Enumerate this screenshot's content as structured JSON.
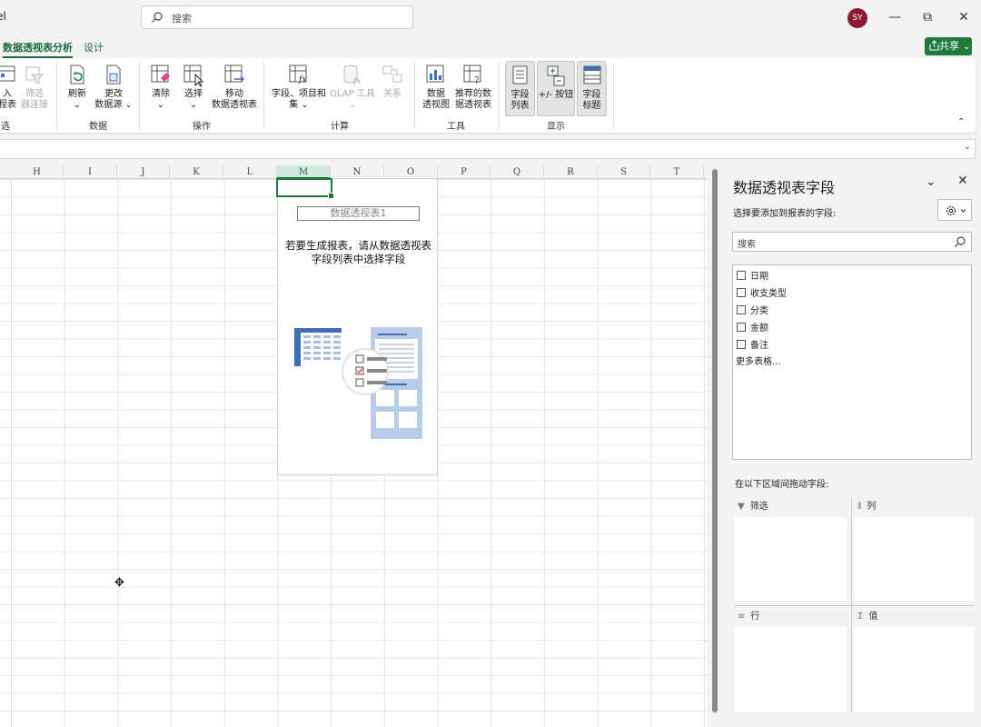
{
  "window": {
    "title_fragment": "el",
    "search_placeholder": "搜索",
    "avatar_initials": "SY",
    "minimize": "—",
    "restore": "⧉",
    "close": "✕"
  },
  "tabs": [
    {
      "label": "数据透视表分析",
      "active": true
    },
    {
      "label": "设计",
      "active": false
    }
  ],
  "share_label": "共享",
  "share_chevron": "⌄",
  "ribbon": {
    "groups": [
      {
        "label": "选",
        "buttons": [
          {
            "label": "入\n程表",
            "icon": "timeline-icon"
          },
          {
            "label": "筛选\n器连接",
            "icon": "filter-connection-icon",
            "disabled": true
          }
        ]
      },
      {
        "label": "数据",
        "buttons": [
          {
            "label": "刷新\n⌄",
            "icon": "refresh-icon"
          },
          {
            "label": "更改\n数据源 ⌄",
            "icon": "change-data-source-icon"
          }
        ]
      },
      {
        "label": "操作",
        "buttons": [
          {
            "label": "清除\n⌄",
            "icon": "clear-icon"
          },
          {
            "label": "选择\n⌄",
            "icon": "select-icon"
          },
          {
            "label": "移动\n数据透视表",
            "icon": "move-pivot-icon"
          }
        ]
      },
      {
        "label": "计算",
        "buttons": [
          {
            "label": "字段、项目和\n集 ⌄",
            "icon": "fields-items-sets-icon"
          },
          {
            "label": "OLAP 工具\n⌄",
            "icon": "olap-tools-icon",
            "disabled": true
          },
          {
            "label": "关系",
            "icon": "relationships-icon",
            "disabled": true
          }
        ]
      },
      {
        "label": "工具",
        "buttons": [
          {
            "label": "数据\n透视图",
            "icon": "pivot-chart-icon"
          },
          {
            "label": "推荐的数\n据透视表",
            "icon": "recommended-pivot-icon"
          }
        ]
      },
      {
        "label": "显示",
        "buttons": [
          {
            "label": "字段\n列表",
            "icon": "field-list-icon",
            "pressed": true
          },
          {
            "label": "+/- 按钮",
            "icon": "plus-minus-buttons-icon",
            "pressed": true
          },
          {
            "label": "字段\n标题",
            "icon": "field-headers-icon",
            "pressed": true
          }
        ]
      }
    ],
    "collapse_glyph": "⌃"
  },
  "formula_bar": {
    "expand_glyph": "⌄"
  },
  "grid": {
    "columns": [
      "H",
      "I",
      "J",
      "K",
      "L",
      "M",
      "N",
      "O",
      "P",
      "Q",
      "R",
      "S",
      "T"
    ],
    "selected_column": "M"
  },
  "pivot_placeholder": {
    "name": "数据透视表1",
    "message": "若要生成报表，请从数据透视表\n字段列表中选择字段"
  },
  "pane": {
    "title": "数据透视表字段",
    "collapse_glyph": "⌄",
    "close_glyph": "✕",
    "subtitle": "选择要添加到报表的字段:",
    "search_placeholder": "搜索",
    "fields": [
      "日期",
      "收支类型",
      "分类",
      "金额",
      "备注"
    ],
    "more_tables": "更多表格...",
    "drag_label": "在以下区域间拖动字段:",
    "areas": [
      {
        "label": "筛选",
        "icon": "▼"
      },
      {
        "label": "列",
        "icon": "⦀"
      },
      {
        "label": "行",
        "icon": "≡"
      },
      {
        "label": "值",
        "icon": "Σ"
      }
    ]
  },
  "colors": {
    "accent_green": "#1b6b39",
    "share_green": "#1f7a3c",
    "avatar": "#8b1c2d",
    "illustration_blue": "#3f6fb5"
  }
}
